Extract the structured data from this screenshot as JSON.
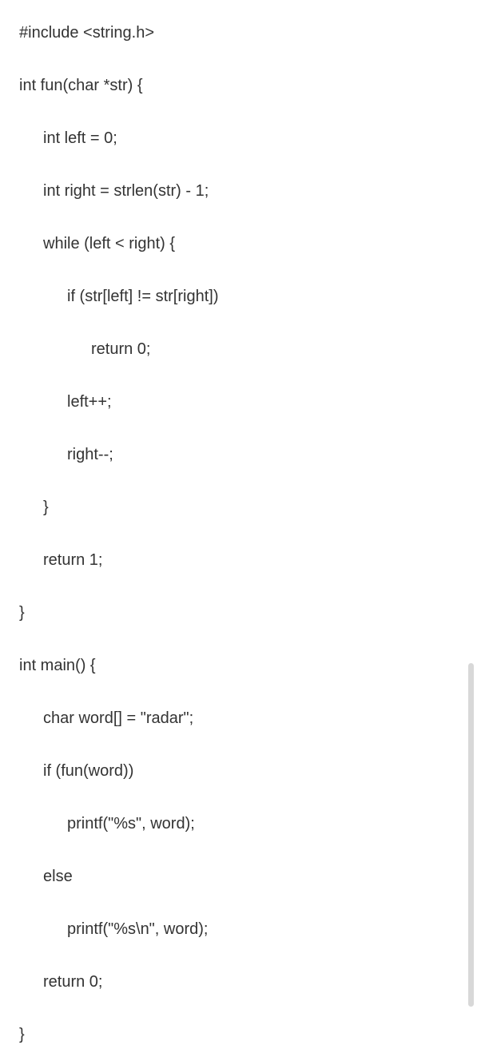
{
  "code": {
    "l1": "#include <string.h>",
    "l2": "int fun(char *str) {",
    "l3": "int left = 0;",
    "l4": "int right = strlen(str) - 1;",
    "l5": "while (left < right) {",
    "l6": "if (str[left] != str[right])",
    "l7": "return 0;",
    "l8": "left++;",
    "l9": "right--;",
    "l10": "}",
    "l11": "return 1;",
    "l12": "}",
    "l13": "int main() {",
    "l14": "char word[] = \"radar\";",
    "l15": "if (fun(word))",
    "l16": "printf(\"%s\", word);",
    "l17": "else",
    "l18": "printf(\"%s\\n\", word);",
    "l19": "return 0;",
    "l20": "}"
  }
}
